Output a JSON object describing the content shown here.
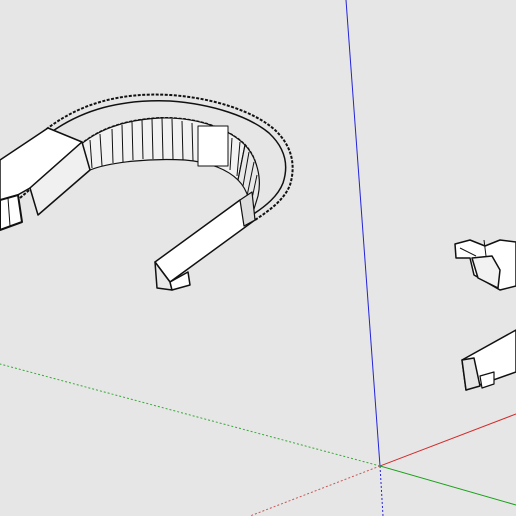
{
  "viewport": {
    "background": "#e6e6e6",
    "axis_colors": {
      "blue": "#2323d8",
      "red": "#d22a2a",
      "green": "#17a017",
      "green_dotted": "#3aa83a",
      "red_dotted": "#c45a5a"
    },
    "model_colors": {
      "face": "#ffffff",
      "face_shade": "#d4d4d4",
      "edge": "#111111"
    },
    "objects": [
      "u-shaped-conveyor-model",
      "right-partial-model"
    ]
  }
}
